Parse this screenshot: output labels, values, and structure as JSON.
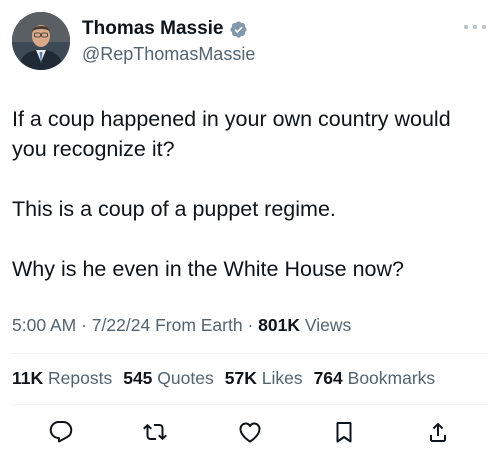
{
  "author": {
    "display_name": "Thomas Massie",
    "handle": "@RepThomasMassie",
    "verified": true,
    "verified_color": "#829aab"
  },
  "tweet": {
    "lines": [
      "If a coup happened in your own country would you recognize it?",
      "This is a coup of a puppet regime.",
      "Why is he even in the White House now?"
    ]
  },
  "meta": {
    "time": "5:00 AM",
    "date": "7/22/24",
    "source": "From Earth",
    "views_count": "801K",
    "views_label": "Views",
    "separator": "·"
  },
  "stats": {
    "reposts_count": "11K",
    "reposts_label": "Reposts",
    "quotes_count": "545",
    "quotes_label": "Quotes",
    "likes_count": "57K",
    "likes_label": "Likes",
    "bookmarks_count": "764",
    "bookmarks_label": "Bookmarks"
  },
  "actions": {
    "icons": [
      "reply-icon",
      "repost-icon",
      "like-icon",
      "bookmark-icon",
      "share-icon"
    ],
    "accent": "#1d9bf0"
  }
}
